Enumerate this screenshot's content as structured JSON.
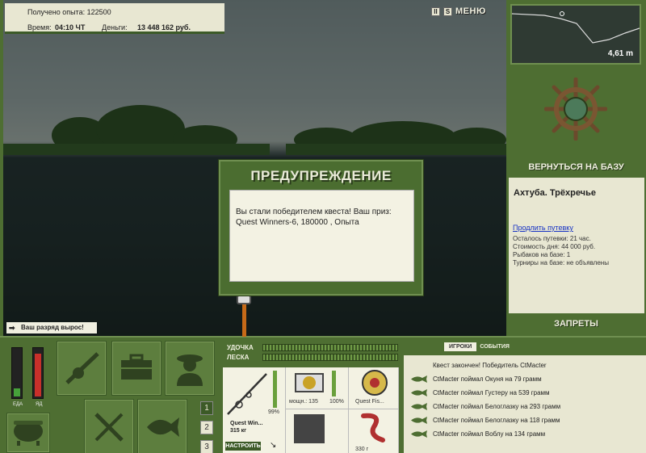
{
  "info": {
    "exp_label": "Получено опыта: 122500",
    "time_label": "Время:",
    "time_value": "04:10 ЧТ",
    "money_label": "Деньги:",
    "money_value": "13 448 162 руб."
  },
  "top_icons": {
    "pause": "II",
    "sound": "S",
    "menu": "МЕНЮ"
  },
  "dialog": {
    "title": "ПРЕДУПРЕЖДЕНИЕ",
    "message": "Вы стали победителем квеста! Ваш приз: Quest Winners-6, 180000 , Опыта"
  },
  "rank_banner": "Ваш разряд вырос!",
  "right_panel": {
    "depth": "4,61 m",
    "return_label": "ВЕРНУТЬСЯ НА БАЗУ",
    "base_name": "Ахтуба. Трёхречье",
    "extend_link": "Продлить путевку",
    "trip_left": "Осталось путевки: 21 час.",
    "day_cost": "Стоимость дня: 44 000 руб.",
    "anglers": "Рыбаков на базе: 1",
    "tournaments": "Турниры на базе: не объявлены",
    "bans_label": "ЗАПРЕТЫ"
  },
  "meters": {
    "food_label": "ЕДА",
    "poison_label": "ЯД",
    "food_level": 0.18,
    "poison_level": 0.92
  },
  "pages": [
    "1",
    "2",
    "3"
  ],
  "bars": {
    "rod_label": "УДОЧКА",
    "line_label": "ЛЕСКА"
  },
  "gear": {
    "rod_pct": "99%",
    "rod_name": "Quest Win...",
    "rod_weight": "315 кг",
    "setup_label": "НАСТРОИТЬ",
    "reel_power": "мощн.: 135",
    "reel_pct": "100%",
    "line_name": "Quest Fis...",
    "bait_weight": "330 г"
  },
  "events": {
    "tab_players": "ИГРОКИ",
    "tab_events": "СОБЫТИЯ",
    "items": [
      "Квест закончен! Победитель CtMacter",
      "CtMacter поймал Окуня на 79 грамм",
      "CtMacter поймал Густеру на 539 грамм",
      "CtMacter поймал Белоглазку на 293 грамм",
      "CtMacter поймал Белоглазку на 118 грамм",
      "CtMacter поймал Воблу на 134 грамм"
    ]
  },
  "colors": {
    "panel": "#4e6e32",
    "accent": "#3c5a27",
    "paper": "#e8e7d2"
  }
}
